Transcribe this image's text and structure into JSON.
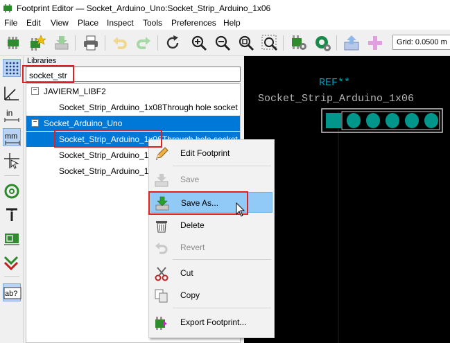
{
  "window": {
    "title": "Footprint Editor — Socket_Arduino_Uno:Socket_Strip_Arduino_1x06"
  },
  "menu": [
    "File",
    "Edit",
    "View",
    "Place",
    "Inspect",
    "Tools",
    "Preferences",
    "Help"
  ],
  "toolbar": {
    "icons": [
      "new-footprint-icon",
      "footprint-wizard-icon",
      "save-icon",
      "print-icon",
      "undo-icon",
      "redo-icon",
      "refresh-icon",
      "zoom-in-icon",
      "zoom-out-icon",
      "zoom-fit-icon",
      "zoom-selection-icon",
      "pad-settings-icon",
      "footprint-check-icon",
      "load-from-board-icon",
      "insert-into-board-icon"
    ],
    "grid_label": "Grid: 0.0500 m"
  },
  "left_toolbar": {
    "icons": [
      "grid-toggle-icon",
      "polar-coords-icon",
      "units-inches-icon",
      "units-mm-icon",
      "full-crosshair-icon",
      "pad-sketch-icon",
      "text-sketch-icon",
      "graphic-sketch-icon",
      "highcontrast-icon",
      "text-display-icon"
    ],
    "in_label": "in",
    "mm_label": "mm",
    "ab_label": "ab?"
  },
  "libraries": {
    "label": "Libraries",
    "search_value": "socket_str",
    "tree": [
      {
        "name": "JAVIERM_LIBF2",
        "kind": "lib",
        "expander": "−",
        "desc": ""
      },
      {
        "name": "Socket_Strip_Arduino_1x08",
        "kind": "fp",
        "desc": "Through hole socket"
      },
      {
        "name": "Socket_Arduino_Uno",
        "kind": "lib",
        "expander": "−",
        "desc": ""
      },
      {
        "name": "Socket_Strip_Arduino_1x06",
        "kind": "fp",
        "desc": "Through hole socket"
      },
      {
        "name": "Socket_Strip_Arduino_1x",
        "kind": "fp",
        "desc": ""
      },
      {
        "name": "Socket_Strip_Arduino_1x",
        "kind": "fp",
        "desc": ""
      }
    ]
  },
  "canvas": {
    "ref_text": "REF**",
    "value_text": "Socket_Strip_Arduino_1x06",
    "colors": {
      "ref": "#009cb4",
      "value": "#b4b4b4",
      "pad": "#00968c",
      "outline": "#c8c8c8",
      "background": "#000000"
    }
  },
  "context_menu": {
    "items": [
      {
        "label": "Edit Footprint",
        "icon": "pencil-icon",
        "enabled": true
      },
      {
        "label": "Save",
        "icon": "save-disabled-icon",
        "enabled": false
      },
      {
        "label": "Save As...",
        "icon": "save-as-icon",
        "enabled": true,
        "highlighted": true
      },
      {
        "label": "Delete",
        "icon": "trash-icon",
        "enabled": true
      },
      {
        "label": "Revert",
        "icon": "revert-icon",
        "enabled": false
      },
      {
        "label": "Cut",
        "icon": "scissors-icon",
        "enabled": true
      },
      {
        "label": "Copy",
        "icon": "copy-icon",
        "enabled": true
      },
      {
        "label": "Export Footprint...",
        "icon": "export-icon",
        "enabled": true
      }
    ]
  },
  "annotation_color": "#e02020"
}
